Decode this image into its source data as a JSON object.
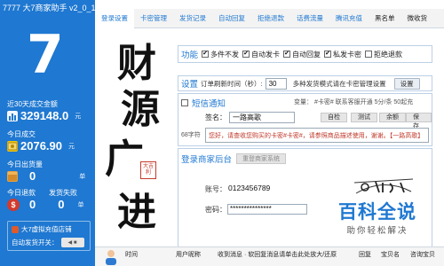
{
  "app": {
    "title": "7777 大7商家助手 v2_0_10."
  },
  "sidebar": {
    "big_number": "7",
    "stats": [
      {
        "label": "近30天成交金额",
        "value": "329148.0",
        "unit": "元",
        "icon": "bar-chart-icon"
      },
      {
        "label": "今日成交",
        "value": "2076.90",
        "unit": "元",
        "icon": "money-icon"
      },
      {
        "label": "今日出货量",
        "value": "0",
        "unit": "单",
        "icon": "package-icon"
      }
    ],
    "refund": {
      "label1": "今日退款",
      "label2": "发货失败",
      "value1": "0",
      "value2": "0",
      "unit": "单"
    },
    "shop": {
      "name": "大7虚拟充值店铺",
      "auto_label": "自动发货开关："
    }
  },
  "tabs": [
    "登录设置",
    "卡密管理",
    "发货记录",
    "自动回复",
    "拒绝退款",
    "话费流量",
    "腾讯充值",
    "黑名单",
    "微收货"
  ],
  "calligraphy": {
    "chars": [
      "财",
      "源",
      "广",
      "进"
    ],
    "seal": "大吉\n利"
  },
  "function": {
    "title": "功能",
    "options": [
      {
        "label": "多件不发",
        "checked": true
      },
      {
        "label": "自动发卡",
        "checked": true
      },
      {
        "label": "自动回复",
        "checked": true
      },
      {
        "label": "私发卡密",
        "checked": true
      },
      {
        "label": "拒绝退款",
        "checked": false
      }
    ]
  },
  "settings": {
    "title": "设置",
    "refresh_label": "订单刷新时间（秒）:",
    "refresh_value": "30",
    "note": "多种发货模式请在卡密管理设置",
    "button": "设置"
  },
  "sms": {
    "title": "短信通知",
    "variables": "变量：  #卡密#  联系客服开通   5分/条 50起充",
    "sign_label": "签名：",
    "sign_value": "一路高歌",
    "btn_open": "自检",
    "btn_test": "测试",
    "btn_balance": "余额",
    "btn_save": "保存",
    "char_count": "68字符",
    "template": "您好，请查收您购买的卡密#卡密#，请参照商品描述使用，谢谢。【一路高歌】"
  },
  "login": {
    "title": "登录商家后台",
    "button": "重登商家系统",
    "account_label": "账号：",
    "account_value": "0123456789",
    "password_label": "密码：",
    "password_value": "***************"
  },
  "watermark": {
    "title": "百科全说",
    "subtitle": "助你轻松解决"
  },
  "table": {
    "columns": [
      "时间",
      "用户昵称",
      "收到消息 · 软回复消息请单击此处放大/还原",
      "回复",
      "宝贝名",
      "咨询宝贝"
    ]
  },
  "colors": {
    "primary": "#1f78d1",
    "accent_red": "#c63b2d"
  }
}
